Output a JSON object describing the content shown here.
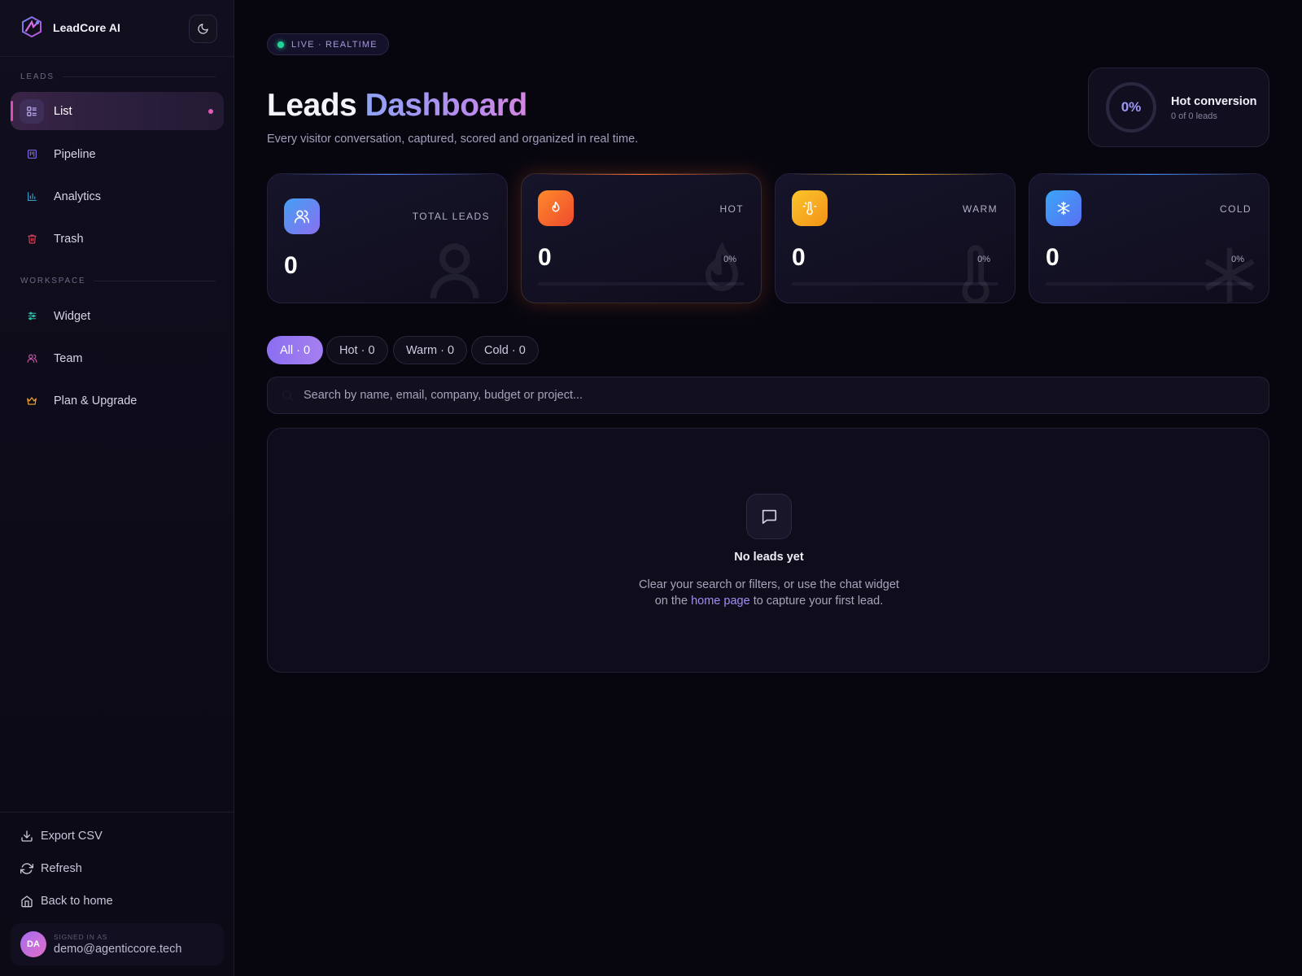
{
  "brand": {
    "name": "LeadCore AI"
  },
  "sidebar": {
    "sections": [
      {
        "label": "LEADS"
      },
      {
        "label": "WORKSPACE"
      }
    ],
    "items": [
      {
        "label": "List",
        "icon": "list-icon",
        "active": true
      },
      {
        "label": "Pipeline",
        "icon": "kanban-icon"
      },
      {
        "label": "Analytics",
        "icon": "bar-chart-icon"
      },
      {
        "label": "Trash",
        "icon": "trash-icon"
      },
      {
        "label": "Widget",
        "icon": "sliders-icon"
      },
      {
        "label": "Team",
        "icon": "users-icon"
      },
      {
        "label": "Plan & Upgrade",
        "icon": "crown-icon"
      }
    ],
    "footer": [
      {
        "label": "Export CSV",
        "icon": "download-icon"
      },
      {
        "label": "Refresh",
        "icon": "refresh-icon"
      },
      {
        "label": "Back to home",
        "icon": "home-icon"
      }
    ],
    "user": {
      "initials": "DA",
      "tag": "SIGNED IN AS",
      "email": "demo@agenticcore.tech"
    }
  },
  "header": {
    "live_label": "LIVE · REALTIME",
    "title_part1": "Leads",
    "title_part2": "Dashboard",
    "subtitle": "Every visitor conversation, captured, scored and organized in real time."
  },
  "conversion": {
    "value": "0%",
    "title": "Hot conversion",
    "subtitle": "0 of 0 leads"
  },
  "stats": [
    {
      "label": "TOTAL LEADS",
      "value": "0",
      "icon": "users-icon",
      "color": "#4f7cf5"
    },
    {
      "label": "HOT",
      "value": "0",
      "percent": "0%",
      "icon": "flame-icon",
      "color": "#ff6a2b"
    },
    {
      "label": "WARM",
      "value": "0",
      "percent": "0%",
      "icon": "thermometer-sun-icon",
      "color": "#f8b21c"
    },
    {
      "label": "COLD",
      "value": "0",
      "percent": "0%",
      "icon": "snowflake-icon",
      "color": "#3f8cf8"
    }
  ],
  "filters": [
    {
      "label": "All · 0",
      "active": true
    },
    {
      "label": "Hot · 0"
    },
    {
      "label": "Warm · 0"
    },
    {
      "label": "Cold · 0"
    }
  ],
  "search": {
    "placeholder": "Search by name, email, company, budget or project...",
    "value": ""
  },
  "empty": {
    "title": "No leads yet",
    "line1": "Clear your search or filters, or use the chat widget",
    "line2_pre": "on the",
    "link": "home page",
    "line2_post": "to capture your first lead."
  }
}
